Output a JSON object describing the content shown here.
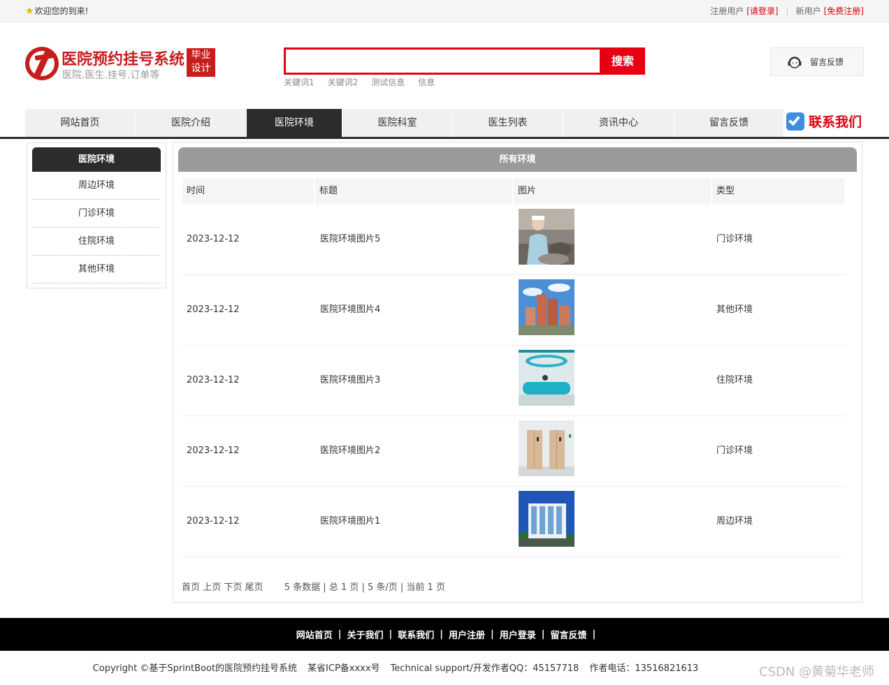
{
  "topbar": {
    "welcome": "欢迎您的到来!",
    "register_user_label": "注册用户",
    "login_link": "[请登录]",
    "new_user_label": "新用户",
    "signup_link": "[免费注册]"
  },
  "header": {
    "site_title": "医院预约挂号系统",
    "subtitle": "医院.医生.挂号.订单等",
    "badge_line1": "毕业",
    "badge_line2": "设计",
    "search_value": "",
    "search_button": "搜索",
    "hotwords": [
      "关键词1",
      "关键词2",
      "测试信息",
      "信息"
    ],
    "feedback": "留言反馈"
  },
  "nav": {
    "items": [
      "网站首页",
      "医院介绍",
      "医院环境",
      "医院科室",
      "医生列表",
      "资讯中心",
      "留言反馈"
    ],
    "active_index": 2,
    "contact": "联系我们"
  },
  "sidebar": {
    "title": "医院环境",
    "items": [
      "周边环境",
      "门诊环境",
      "住院环境",
      "其他环境"
    ]
  },
  "main": {
    "title": "所有环境",
    "columns": [
      "时间",
      "标题",
      "图片",
      "类型"
    ],
    "rows": [
      {
        "time": "2023-12-12",
        "title": "医院环境图片5",
        "type": "门诊环境",
        "image": "nurse-photo"
      },
      {
        "time": "2023-12-12",
        "title": "医院环境图片4",
        "type": "其他环境",
        "image": "hospital-building-photo"
      },
      {
        "time": "2023-12-12",
        "title": "医院环境图片3",
        "type": "住院环境",
        "image": "reception-desk-photo"
      },
      {
        "time": "2023-12-12",
        "title": "医院环境图片2",
        "type": "门诊环境",
        "image": "elevator-doors-photo"
      },
      {
        "time": "2023-12-12",
        "title": "医院环境图片1",
        "type": "周边环境",
        "image": "building-exterior-photo"
      }
    ],
    "pager": {
      "first": "首页",
      "prev": "上页",
      "next": "下页",
      "last": "尾页",
      "summary": "5 条数据 | 总 1 页 | 5 条/页 | 当前 1 页"
    }
  },
  "footer": {
    "links": [
      "网站首页",
      "关于我们",
      "联系我们",
      "用户注册",
      "用户登录",
      "留言反馈"
    ],
    "copyright": "Copyright ©基于SprintBoot的医院预约挂号系统",
    "icp": "某省ICP备xxxx号",
    "support": "Technical support/开发作者QQ：45157718",
    "phone": "作者电话：13516821613",
    "watermark": "CSDN @黄菊华老师"
  },
  "colors": {
    "brand_red": "#c81d1d",
    "search_red": "#e60012",
    "dark": "#2c2c2c",
    "panel_head_gray": "#9a9a9a"
  }
}
